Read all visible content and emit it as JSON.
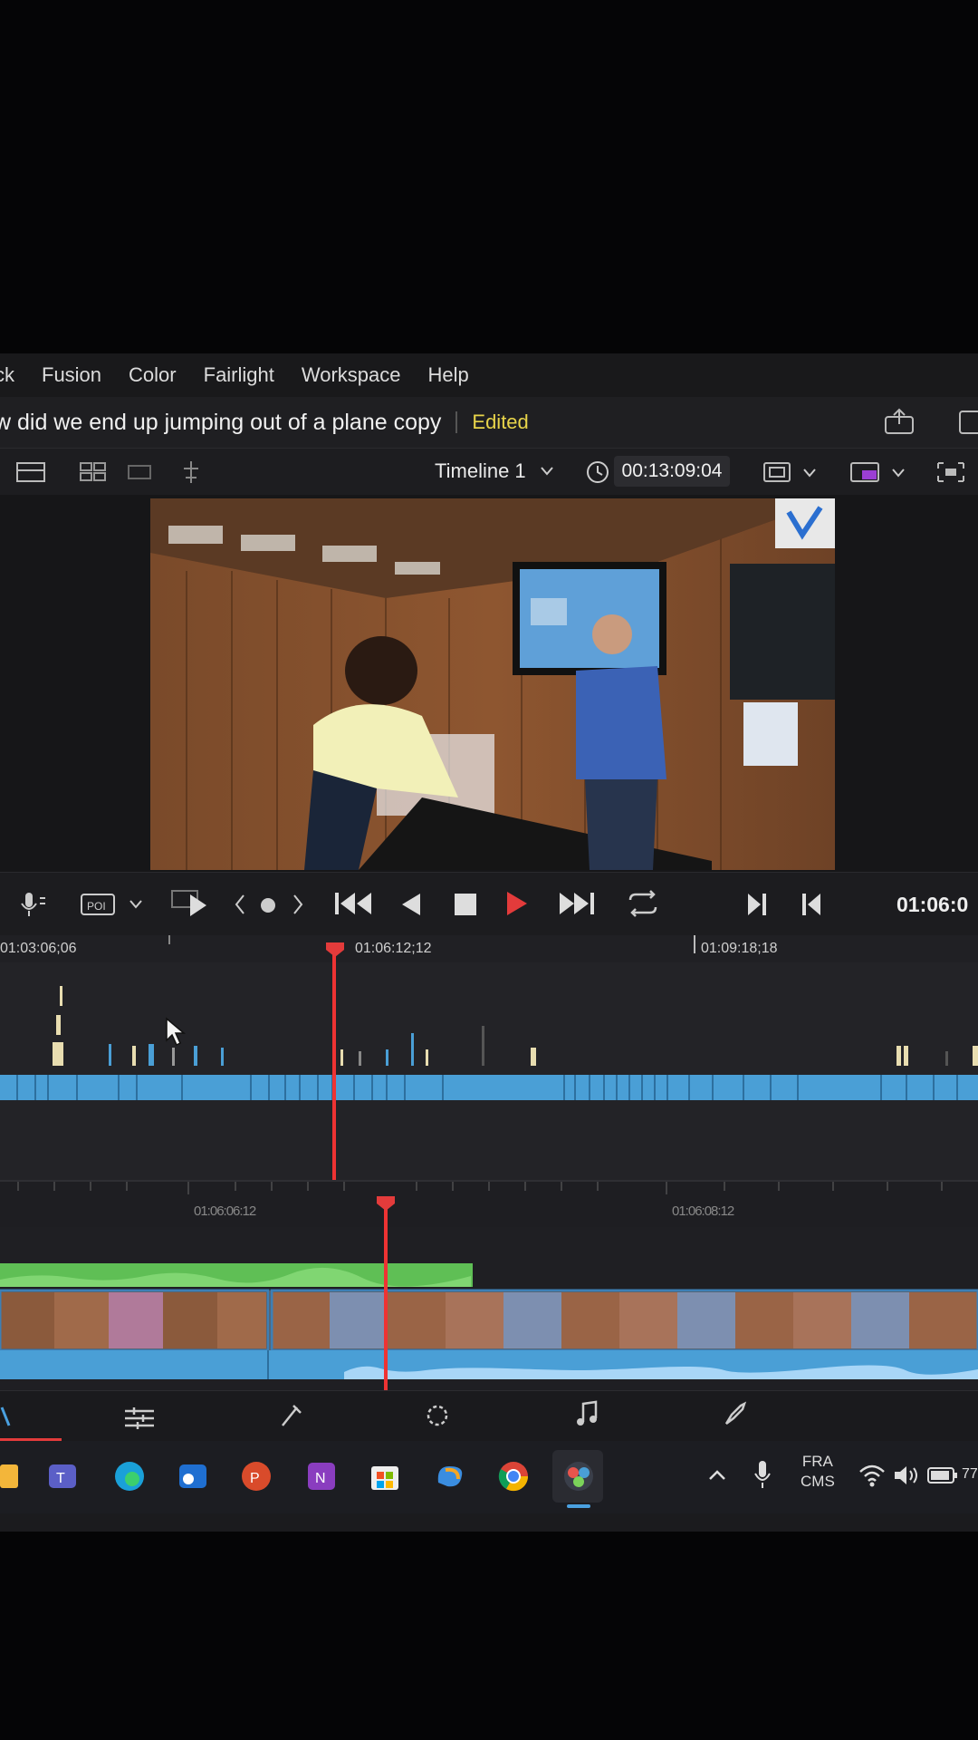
{
  "menu": [
    "ck",
    "Fusion",
    "Color",
    "Fairlight",
    "Workspace",
    "Help"
  ],
  "project": {
    "title": "w did we end up jumping out of a plane copy",
    "status": "Edited"
  },
  "viewer_toolbar": {
    "timeline_name": "Timeline 1",
    "timecode": "00:13:09:04"
  },
  "transport": {
    "current_timecode": "01:06:0"
  },
  "timeline_ruler_top": [
    "01:03:06;06",
    "01:06:12;12",
    "01:09:18;18"
  ],
  "timeline_ruler_bottom": [
    "01:06:06:12",
    "01:06:08:12"
  ],
  "taskbar": {
    "lang": "FRA",
    "ime": "CMS",
    "battery": "77"
  },
  "colors": {
    "accent": "#e33b3b",
    "clip_blue": "#4a9fd6",
    "edited": "#e8d44a",
    "audio_green": "#5fbf55"
  }
}
